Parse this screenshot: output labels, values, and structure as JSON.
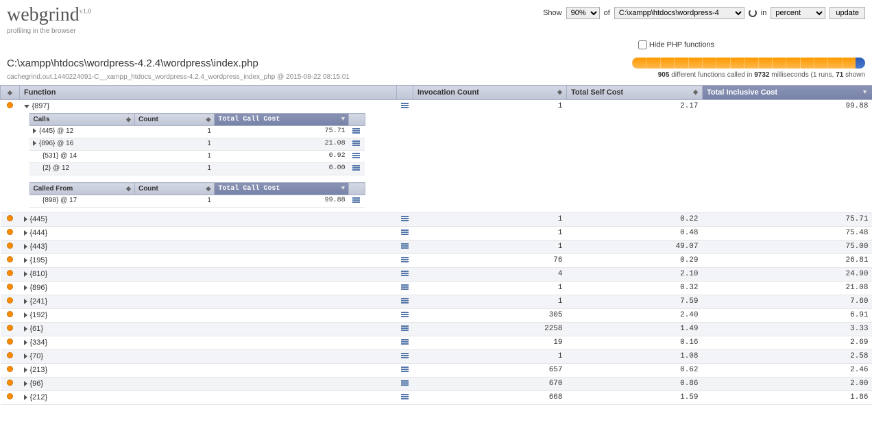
{
  "header": {
    "logo_main": "webgrind",
    "logo_version": "v1.0",
    "tagline": "profiling in the browser"
  },
  "controls": {
    "show_label": "Show",
    "show_value": "90%",
    "of_label": "of",
    "file_value": "C:\\xampp\\htdocs\\wordpress-4",
    "in_label": "in",
    "unit_value": "percent",
    "update_label": "update",
    "hide_php_label": "Hide PHP functions"
  },
  "subheader": {
    "path": "C:\\xampp\\htdocs\\wordpress-4.2.4\\wordpress\\index.php",
    "cache_line": "cachegrind.out.1440224091-C__xampp_htdocs_wordpress-4.2.4_wordpress_index_php @ 2015-08-22 08:15:01",
    "summary_prefix": "different functions called in",
    "functions_count": "905",
    "ms_value": "9732",
    "summary_suffix1": "milliseconds (1 runs,",
    "shown_count": "71",
    "summary_suffix2": "shown"
  },
  "columns": {
    "function": "Function",
    "invocation": "Invocation Count",
    "self_cost": "Total Self Cost",
    "inclusive": "Total Inclusive Cost"
  },
  "expanded": {
    "name": "{897}",
    "invocation": "1",
    "self_cost": "2.17",
    "inclusive": "99.88",
    "calls_header": {
      "calls": "Calls",
      "count": "Count",
      "cost": "Total Call Cost"
    },
    "calls": [
      {
        "name": "{445} @ 12",
        "count": "1",
        "cost": "75.71",
        "expandable": true
      },
      {
        "name": "{896} @ 16",
        "count": "1",
        "cost": "21.08",
        "expandable": true
      },
      {
        "name": "{531} @ 14",
        "count": "1",
        "cost": "0.92",
        "expandable": false
      },
      {
        "name": "{2} @ 12",
        "count": "1",
        "cost": "0.00",
        "expandable": false
      }
    ],
    "called_from_header": {
      "calls": "Called From",
      "count": "Count",
      "cost": "Total Call Cost"
    },
    "called_from": [
      {
        "name": "{898} @ 17",
        "count": "1",
        "cost": "99.88"
      }
    ]
  },
  "rows": [
    {
      "name": "{445}",
      "invocation": "1",
      "self_cost": "0.22",
      "inclusive": "75.71"
    },
    {
      "name": "{444}",
      "invocation": "1",
      "self_cost": "0.48",
      "inclusive": "75.48"
    },
    {
      "name": "{443}",
      "invocation": "1",
      "self_cost": "49.07",
      "inclusive": "75.00"
    },
    {
      "name": "{195}",
      "invocation": "76",
      "self_cost": "0.29",
      "inclusive": "26.81"
    },
    {
      "name": "{810}",
      "invocation": "4",
      "self_cost": "2.10",
      "inclusive": "24.90"
    },
    {
      "name": "{896}",
      "invocation": "1",
      "self_cost": "0.32",
      "inclusive": "21.08"
    },
    {
      "name": "{241}",
      "invocation": "1",
      "self_cost": "7.59",
      "inclusive": "7.60"
    },
    {
      "name": "{192}",
      "invocation": "305",
      "self_cost": "2.40",
      "inclusive": "6.91"
    },
    {
      "name": "{61}",
      "invocation": "2258",
      "self_cost": "1.49",
      "inclusive": "3.33"
    },
    {
      "name": "{334}",
      "invocation": "19",
      "self_cost": "0.16",
      "inclusive": "2.69"
    },
    {
      "name": "{70}",
      "invocation": "1",
      "self_cost": "1.08",
      "inclusive": "2.58"
    },
    {
      "name": "{213}",
      "invocation": "657",
      "self_cost": "0.62",
      "inclusive": "2.46"
    },
    {
      "name": "{96}",
      "invocation": "670",
      "self_cost": "0.86",
      "inclusive": "2.00"
    },
    {
      "name": "{212}",
      "invocation": "668",
      "self_cost": "1.59",
      "inclusive": "1.86"
    }
  ]
}
